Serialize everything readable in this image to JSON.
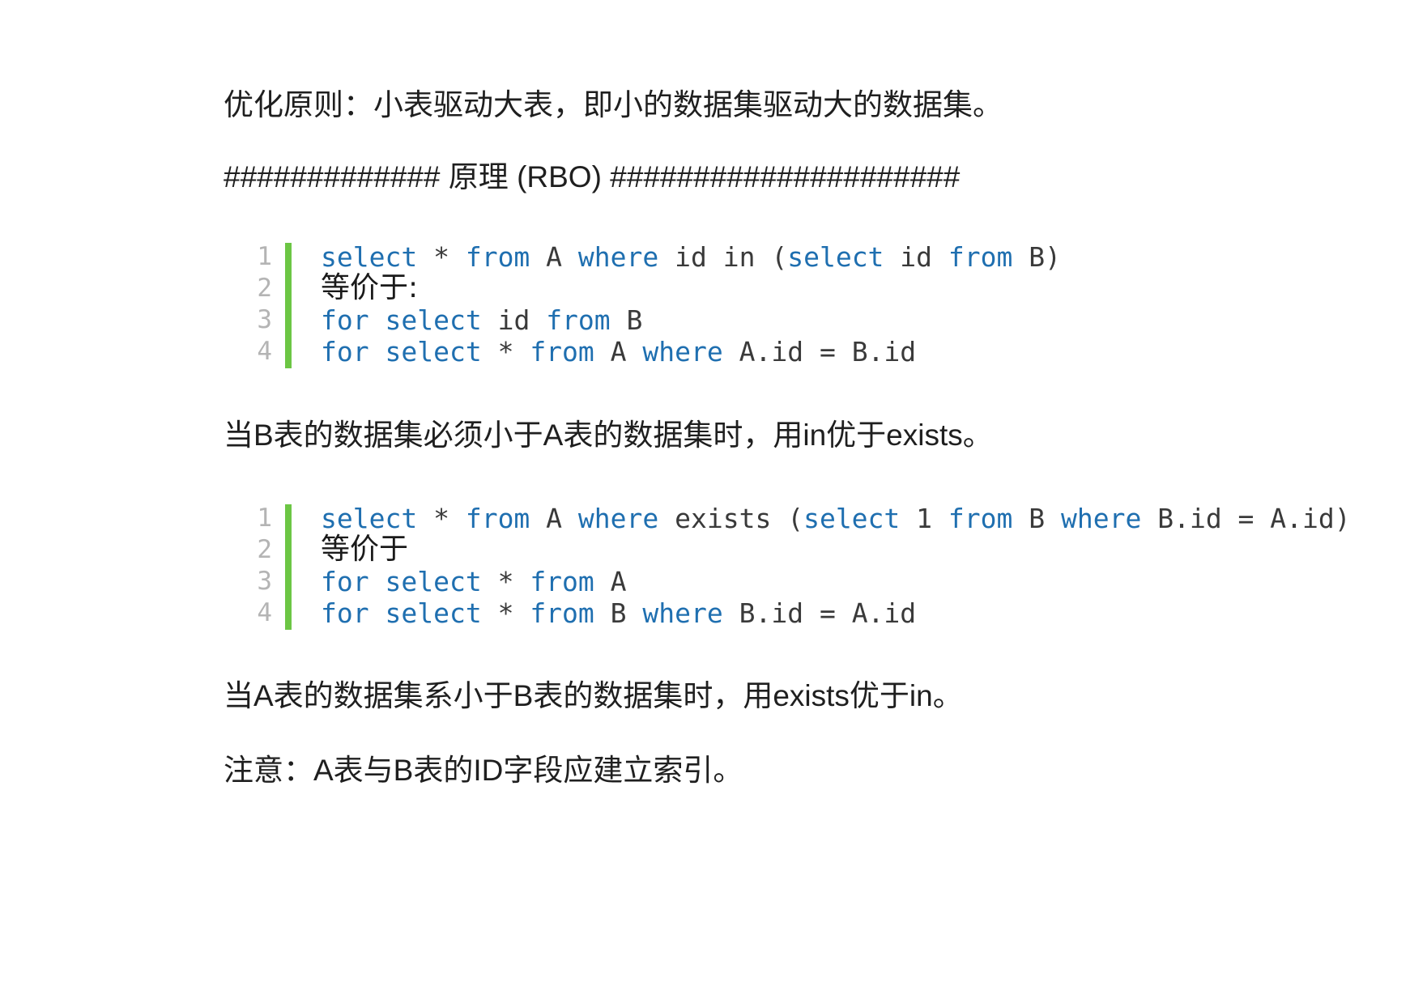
{
  "paragraphs": {
    "principle": "优化原则：小表驱动大表，即小的数据集驱动大的数据集。",
    "rbo_heading": "############# 原理 (RBO) #####################",
    "in_conclusion": "当B表的数据集必须小于A表的数据集时，用in优于exists。",
    "exists_conclusion": "当A表的数据集系小于B表的数据集时，用exists优于in。",
    "note": "注意：A表与B表的ID字段应建立索引。"
  },
  "code_block_1": {
    "line_numbers": [
      "1",
      "2",
      "3",
      "4"
    ],
    "lines": [
      {
        "kw1": "select",
        "t1": " * ",
        "kw2": "from",
        "t2": " A ",
        "kw3": "where",
        "t3": " id in (",
        "kw4": "select",
        "t4": " id ",
        "kw5": "from",
        "t5": " B)"
      },
      {
        "text": "等价于:"
      },
      {
        "kw1": "for",
        "t1": " ",
        "kw2": "select",
        "t2": " id ",
        "kw3": "from",
        "t3": " B"
      },
      {
        "kw1": "for",
        "t1": " ",
        "kw2": "select",
        "t2": " * ",
        "kw3": "from",
        "t3": " A ",
        "kw4": "where",
        "t4": " A.id = B.id"
      }
    ]
  },
  "code_block_2": {
    "line_numbers": [
      "1",
      "2",
      "3",
      "4"
    ],
    "lines": [
      {
        "kw1": "select",
        "t1": " * ",
        "kw2": "from",
        "t2": " A ",
        "kw3": "where",
        "t3": " exists (",
        "kw4": "select",
        "t4": " 1 ",
        "kw5": "from",
        "t5": " B ",
        "kw6": "where",
        "t6": " B.id = A.id)"
      },
      {
        "text": "等价于"
      },
      {
        "kw1": "for",
        "t1": " ",
        "kw2": "select",
        "t2": " * ",
        "kw3": "from",
        "t3": " A"
      },
      {
        "kw1": "for",
        "t1": " ",
        "kw2": "select",
        "t2": " * ",
        "kw3": "from",
        "t3": " B ",
        "kw4": "where",
        "t4": " B.id = A.id"
      }
    ]
  },
  "colors": {
    "keyword": "#1f6fb0",
    "line_number": "#b4b4b4",
    "gutter_bar": "#6cc644",
    "text": "#1f1f1f"
  }
}
